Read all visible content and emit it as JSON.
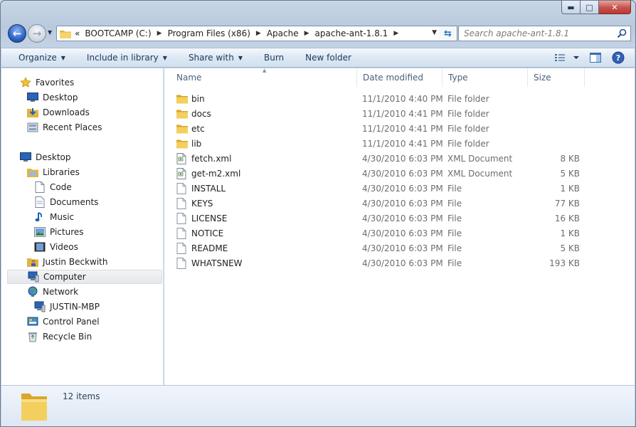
{
  "window": {
    "caption_buttons": {
      "minimize": "▬",
      "maximize": "□",
      "close": "✕"
    }
  },
  "address_bar": {
    "overflow": "«",
    "crumbs": [
      "BOOTCAMP (C:)",
      "Program Files (x86)",
      "Apache",
      "apache-ant-1.8.1"
    ]
  },
  "search": {
    "placeholder": "Search apache-ant-1.8.1"
  },
  "command_bar": {
    "organize": "Organize",
    "include_in_library": "Include in library",
    "share_with": "Share with",
    "burn": "Burn",
    "new_folder": "New folder"
  },
  "nav_pane": {
    "favorites": "Favorites",
    "desktop_fav": "Desktop",
    "downloads": "Downloads",
    "recent_places": "Recent Places",
    "desktop": "Desktop",
    "libraries": "Libraries",
    "code": "Code",
    "documents": "Documents",
    "music": "Music",
    "pictures": "Pictures",
    "videos": "Videos",
    "user": "Justin Beckwith",
    "computer": "Computer",
    "network": "Network",
    "justin_mbp": "JUSTIN-MBP",
    "control_panel": "Control Panel",
    "recycle_bin": "Recycle Bin"
  },
  "columns": {
    "name": "Name",
    "date_modified": "Date modified",
    "type": "Type",
    "size": "Size"
  },
  "files": [
    {
      "name": "bin",
      "date": "11/1/2010 4:40 PM",
      "type": "File folder",
      "size": "",
      "icon": "folder-icon"
    },
    {
      "name": "docs",
      "date": "11/1/2010 4:41 PM",
      "type": "File folder",
      "size": "",
      "icon": "folder-icon"
    },
    {
      "name": "etc",
      "date": "11/1/2010 4:41 PM",
      "type": "File folder",
      "size": "",
      "icon": "folder-icon"
    },
    {
      "name": "lib",
      "date": "11/1/2010 4:41 PM",
      "type": "File folder",
      "size": "",
      "icon": "folder-icon"
    },
    {
      "name": "fetch.xml",
      "date": "4/30/2010 6:03 PM",
      "type": "XML Document",
      "size": "8 KB",
      "icon": "xml-document-icon"
    },
    {
      "name": "get-m2.xml",
      "date": "4/30/2010 6:03 PM",
      "type": "XML Document",
      "size": "5 KB",
      "icon": "xml-document-icon"
    },
    {
      "name": "INSTALL",
      "date": "4/30/2010 6:03 PM",
      "type": "File",
      "size": "1 KB",
      "icon": "file-icon"
    },
    {
      "name": "KEYS",
      "date": "4/30/2010 6:03 PM",
      "type": "File",
      "size": "77 KB",
      "icon": "file-icon"
    },
    {
      "name": "LICENSE",
      "date": "4/30/2010 6:03 PM",
      "type": "File",
      "size": "16 KB",
      "icon": "file-icon"
    },
    {
      "name": "NOTICE",
      "date": "4/30/2010 6:03 PM",
      "type": "File",
      "size": "1 KB",
      "icon": "file-icon"
    },
    {
      "name": "README",
      "date": "4/30/2010 6:03 PM",
      "type": "File",
      "size": "5 KB",
      "icon": "file-icon"
    },
    {
      "name": "WHATSNEW",
      "date": "4/30/2010 6:03 PM",
      "type": "File",
      "size": "193 KB",
      "icon": "file-icon"
    }
  ],
  "details_pane": {
    "item_count": "12 items"
  },
  "colors": {
    "chrome": "#c8d6e6",
    "command_text": "#1e395b",
    "folder": "#f2c94c",
    "header_text": "#4c607a",
    "secondary_text": "#6d6d6d"
  }
}
